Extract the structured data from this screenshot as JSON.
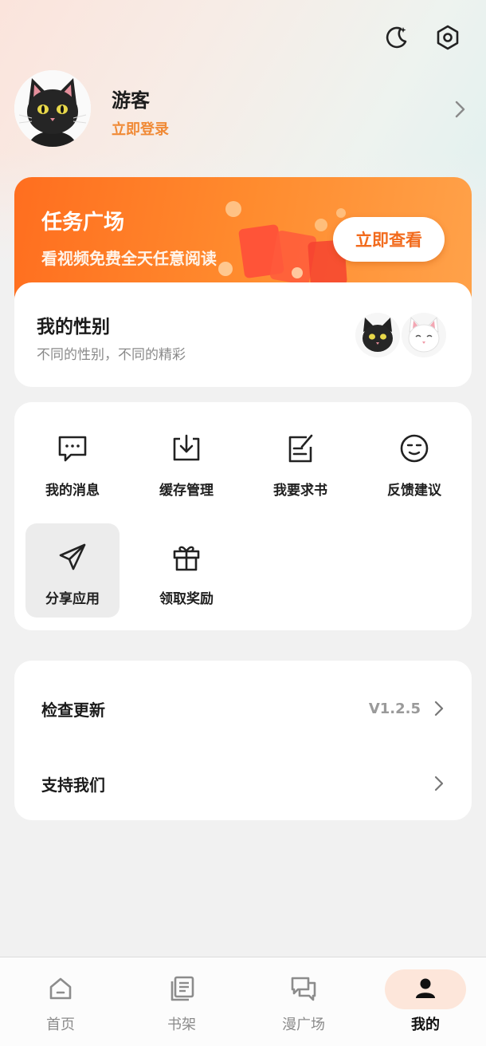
{
  "profile": {
    "username": "游客",
    "login_link": "立即登录"
  },
  "task": {
    "title": "任务广场",
    "subtitle": "看视频免费全天任意阅读",
    "button": "立即查看"
  },
  "gender": {
    "title": "我的性别",
    "subtitle": "不同的性别，不同的精彩"
  },
  "grid": {
    "items": [
      {
        "label": "我的消息",
        "icon": "message-icon"
      },
      {
        "label": "缓存管理",
        "icon": "download-icon"
      },
      {
        "label": "我要求书",
        "icon": "edit-note-icon"
      },
      {
        "label": "反馈建议",
        "icon": "face-icon"
      },
      {
        "label": "分享应用",
        "icon": "send-icon"
      },
      {
        "label": "领取奖励",
        "icon": "gift-icon"
      }
    ]
  },
  "settings": {
    "update_label": "检查更新",
    "update_version": "V1.2.5",
    "support_label": "支持我们"
  },
  "tabs": [
    {
      "label": "首页",
      "icon": "home-icon"
    },
    {
      "label": "书架",
      "icon": "bookshelf-icon"
    },
    {
      "label": "漫广场",
      "icon": "chat-icon"
    },
    {
      "label": "我的",
      "icon": "user-icon"
    }
  ],
  "colors": {
    "accent": "#ff7a24",
    "login": "#f08a36",
    "page_bg": "#f1f1f1"
  }
}
